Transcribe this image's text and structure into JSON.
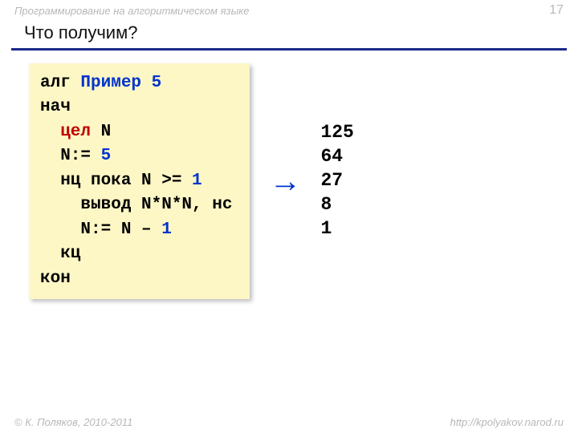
{
  "header": {
    "topic": "Программирование на алгоритмическом языке",
    "page": "17"
  },
  "title": "Что получим?",
  "code": {
    "l1_kw": "алг ",
    "l1_name": "Пример 5",
    "l2": "нач",
    "l3_type": "  цел ",
    "l3_rest": "N",
    "l4_a": "  N:= ",
    "l4_num": "5",
    "l5_a": "  нц пока N >= ",
    "l5_num": "1",
    "l6": "    вывод N*N*N, нс",
    "l7_a": "    N:= N – ",
    "l7_num": "1",
    "l8": "  кц",
    "l9": "кон"
  },
  "arrow": "→",
  "output": "125\n64\n27\n8\n1",
  "footer": {
    "copyright": "© К. Поляков, 2010-2011",
    "url": "http://kpolyakov.narod.ru"
  }
}
